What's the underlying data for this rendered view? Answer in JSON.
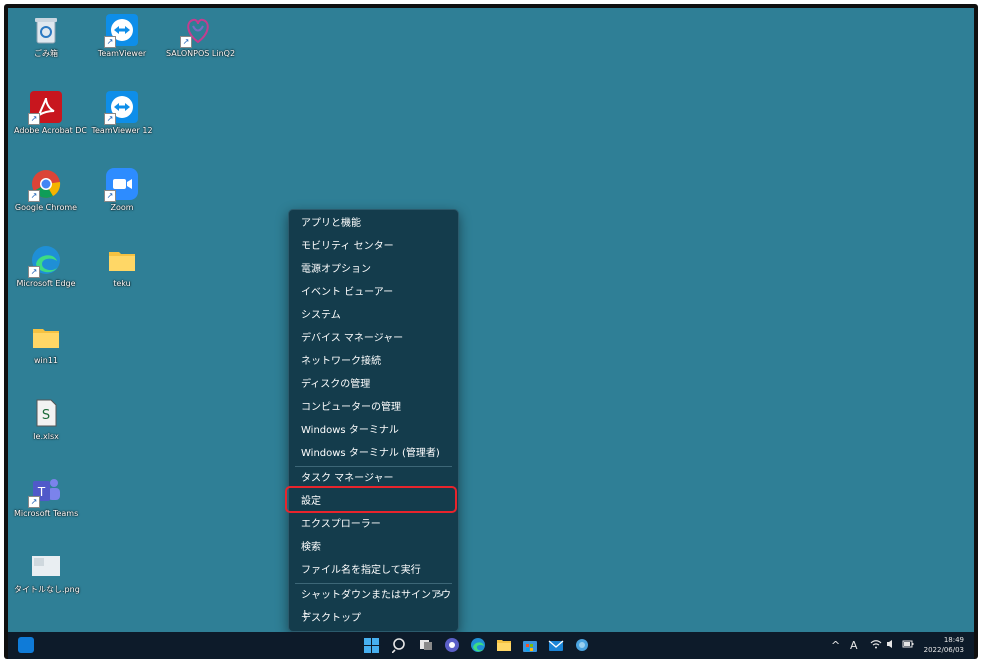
{
  "desktop": {
    "icons": [
      {
        "label": "ごみ箱"
      },
      {
        "label": "TeamViewer"
      },
      {
        "label": "SALONPOS LinQ2"
      },
      {
        "label": "Adobe Acrobat DC"
      },
      {
        "label": "TeamViewer 12"
      },
      {
        "label": "Google Chrome"
      },
      {
        "label": "Zoom"
      },
      {
        "label": "Microsoft Edge"
      },
      {
        "label": "teku"
      },
      {
        "label": "win11"
      },
      {
        "label": "Ie.xlsx"
      },
      {
        "label": "Microsoft Teams"
      },
      {
        "label": "タイトルなし.png"
      }
    ]
  },
  "context_menu": {
    "items": [
      "アプリと機能",
      "モビリティ センター",
      "電源オプション",
      "イベント ビューアー",
      "システム",
      "デバイス マネージャー",
      "ネットワーク接続",
      "ディスクの管理",
      "コンピューターの管理",
      "Windows ターミナル",
      "Windows ターミナル (管理者)",
      "タスク マネージャー",
      "設定",
      "エクスプローラー",
      "検索",
      "ファイル名を指定して実行",
      "シャットダウンまたはサインアウト",
      "デスクトップ"
    ],
    "submenu_arrow": ">",
    "highlighted": "設定",
    "highlight_color": "#e8242c"
  },
  "taskbar": {
    "tray_caret": "^",
    "ime": "A",
    "time": "18:49",
    "date": "2022/06/03"
  },
  "colors": {
    "desktop": "#2f7f96",
    "menu_bg": "#143c4c",
    "taskbar": "#0d1b2a"
  }
}
